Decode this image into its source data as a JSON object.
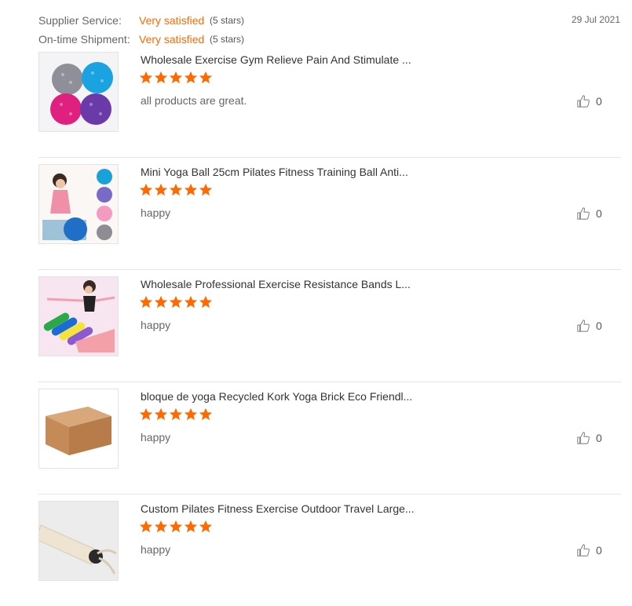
{
  "summary": {
    "supplier_service_label": "Supplier Service:",
    "supplier_service_value": "Very satisfied",
    "supplier_service_stars": "(5 stars)",
    "shipment_label": "On-time Shipment:",
    "shipment_value": "Very satisfied",
    "shipment_stars": "(5 stars)",
    "date": "29 Jul 2021"
  },
  "colors": {
    "accent": "#ff6a00",
    "star": "#ff6a00",
    "divider": "#e6e6e6"
  },
  "reviews": [
    {
      "title": "Wholesale Exercise Gym Relieve Pain And Stimulate ...",
      "rating": 5,
      "comment": "all products are great.",
      "likes": "0",
      "image_icon": "massage-balls-image"
    },
    {
      "title": "Mini Yoga Ball 25cm Pilates Fitness Training Ball Anti...",
      "rating": 5,
      "comment": "happy",
      "likes": "0",
      "image_icon": "yoga-ball-image"
    },
    {
      "title": "Wholesale Professional Exercise Resistance Bands L...",
      "rating": 5,
      "comment": "happy",
      "likes": "0",
      "image_icon": "resistance-bands-image"
    },
    {
      "title": "bloque de yoga Recycled Kork Yoga Brick Eco Friendl...",
      "rating": 5,
      "comment": "happy",
      "likes": "0",
      "image_icon": "cork-yoga-brick-image"
    },
    {
      "title": "Custom Pilates Fitness Exercise Outdoor Travel Large...",
      "rating": 5,
      "comment": "happy",
      "likes": "0",
      "image_icon": "drawstring-bag-image"
    }
  ]
}
